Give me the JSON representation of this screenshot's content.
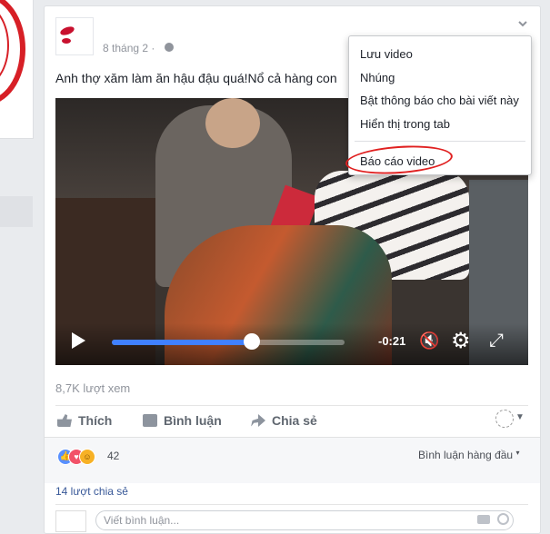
{
  "post": {
    "author": "",
    "timestamp": "8 tháng 2 ·",
    "caption": "Anh thợ xăm làm ăn hậu đậu quá!Nổ cả hàng con",
    "video": {
      "time_remaining": "-0:21",
      "progress": 0.6
    },
    "views": "8,7K lượt xem",
    "actions": {
      "like": "Thích",
      "comment": "Bình luận",
      "share": "Chia sẻ"
    },
    "reactions": {
      "count": "42",
      "sort_label": "Bình luận hàng đầu"
    },
    "shares": "14 lượt chia sẻ",
    "comment_placeholder": "Viết bình luận..."
  },
  "menu": {
    "items": [
      "Lưu video",
      "Nhúng",
      "Bật thông báo cho bài viết này",
      "Hiển thị trong tab",
      "Báo cáo video"
    ]
  },
  "icons": {
    "globe": "globe-icon",
    "chevron": "chevron-down-icon",
    "play": "play-icon",
    "mute": "mute-icon",
    "settings": "gear-icon",
    "fullscreen": "fullscreen-icon"
  },
  "colors": {
    "accent": "#4080ff",
    "link": "#365899",
    "annotation": "#e02020"
  }
}
